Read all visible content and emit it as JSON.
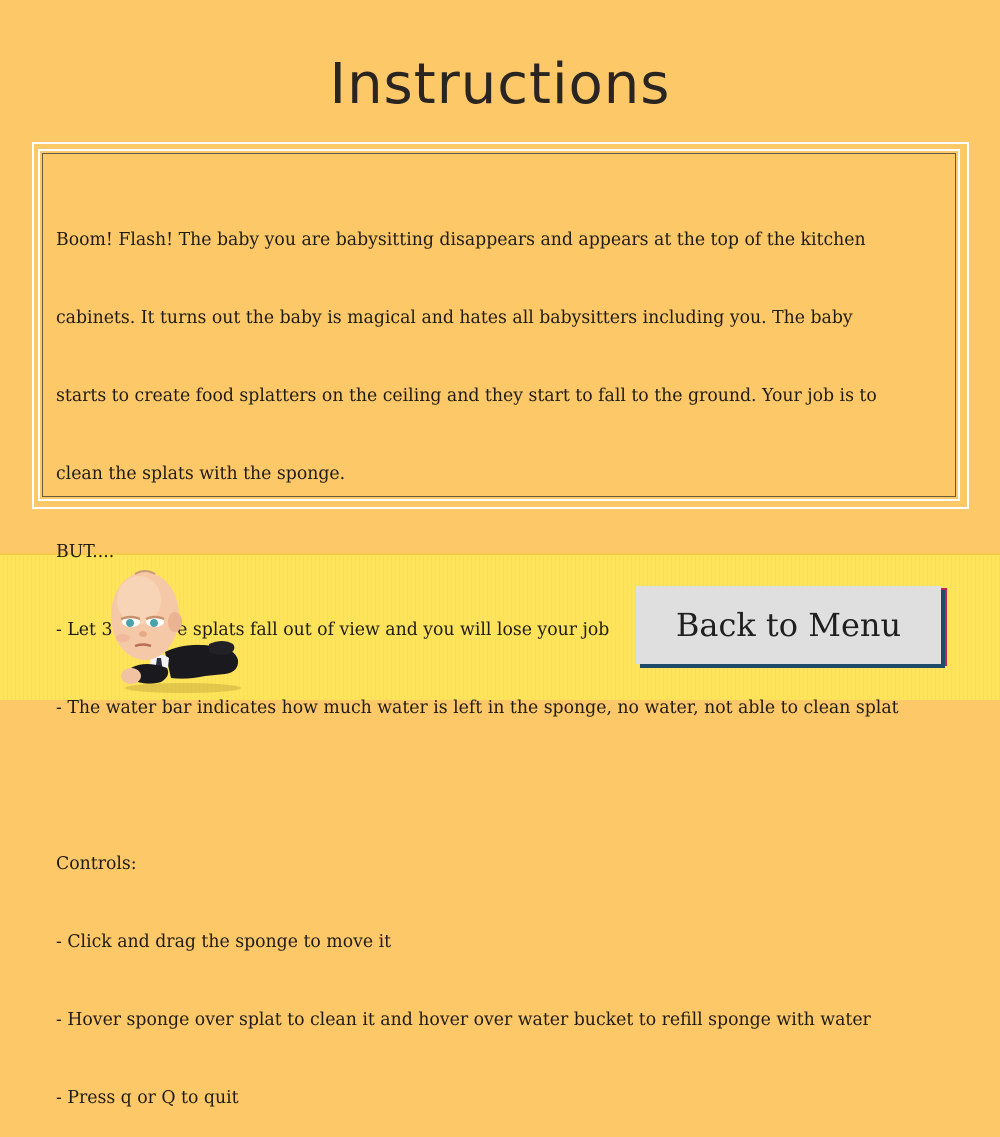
{
  "screen": {
    "title": "Instructions"
  },
  "instructions": {
    "lines": [
      "Boom! Flash! The baby you are babysitting disappears and appears at the top of the kitchen",
      "cabinets.  It turns out the baby is magical and hates all babysitters including you. The baby",
      "starts to create food splatters on the ceiling and they start to fall to the ground. Your job is to",
      "clean the splats with the sponge.",
      "BUT....",
      "- Let 3 or more splats fall out of view and you will lose your job",
      "- The water bar indicates how much water is left in the sponge, no water, not able to clean splat",
      "",
      "Controls:",
      "- Click and drag the sponge to move it",
      "- Hover sponge over splat to clean it and hover over water bucket to refill sponge with water",
      "- Press q or Q to quit"
    ]
  },
  "buttons": {
    "back_to_menu": "Back to Menu"
  },
  "colors": {
    "wall": "#fdc968",
    "floor": "#fde45b",
    "button_face": "#dfdfdf",
    "button_shadow_blue": "#1e4a6a",
    "button_shadow_red": "#c0244a",
    "text": "#1f1a14"
  },
  "sprites": {
    "baby": "boss-baby-lying-sprite"
  }
}
